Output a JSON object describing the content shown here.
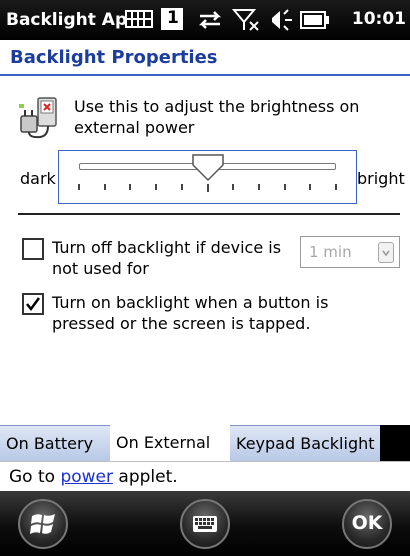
{
  "status_bar": {
    "app_title": "Backlight Ap",
    "sim_number": "1",
    "time": "10:01"
  },
  "header": {
    "title": "Backlight Properties"
  },
  "brightness": {
    "description": "Use this to adjust the brightness on external power",
    "min_label": "dark",
    "max_label": "bright",
    "level_fraction": 0.5
  },
  "options": {
    "turn_off_label": "Turn off backlight if device is not used for",
    "turn_off_checked": false,
    "timeout_value": "1 min",
    "turn_on_label": "Turn on backlight when a button is pressed or the screen is tapped.",
    "turn_on_checked": true
  },
  "tabs": {
    "on_battery": "On Battery",
    "on_external": "On External",
    "keypad_backlight": "Keypad Backlight",
    "active": "On External"
  },
  "footer": {
    "prefix": "Go to ",
    "link": "power",
    "suffix": " applet."
  },
  "softkeys": {
    "ok_label": "OK"
  }
}
